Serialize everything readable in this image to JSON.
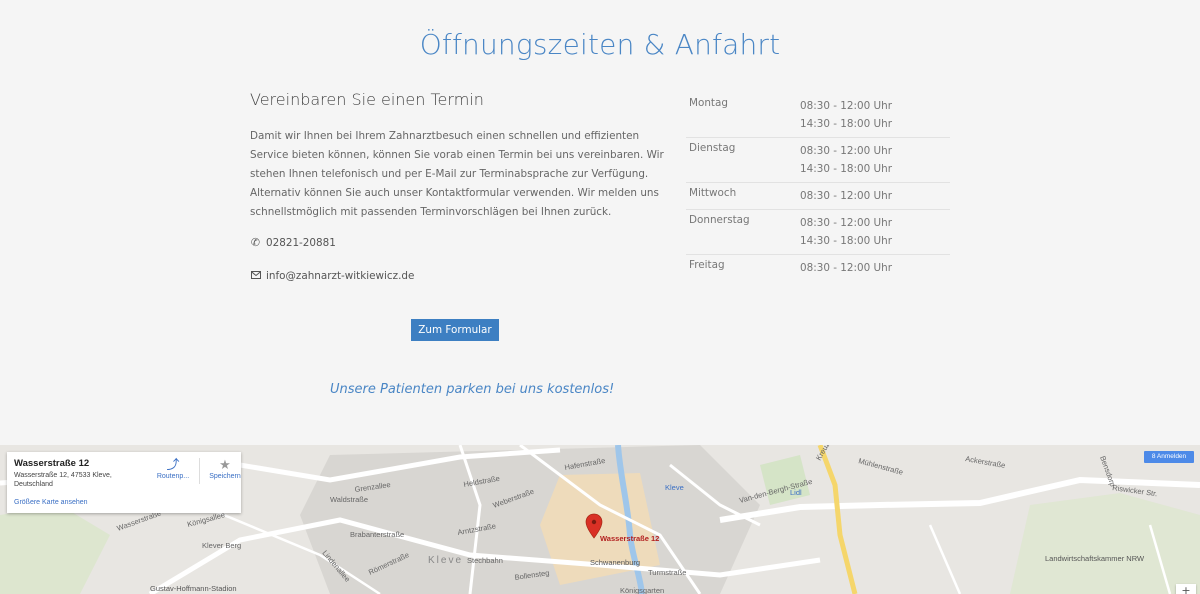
{
  "section": {
    "title": "Öffnungszeiten & Anfahrt",
    "subtitle": "Vereinbaren Sie einen Termin",
    "paragraph": "Damit wir Ihnen bei Ihrem Zahnarztbesuch einen schnellen und effizienten Service bieten können, können Sie vorab einen Termin bei uns vereinbaren. Wir stehen Ihnen telefonisch und per E-Mail zur Terminabsprache zur Verfügung. Alternativ können Sie auch unser Kontaktformular verwenden. Wir melden uns schnellstmöglich mit passenden Terminvorschlägen bei Ihnen zurück.",
    "phone": "02821-20881",
    "email": "info@zahnarzt-witkiewicz.de",
    "form_button": "Zum Formular",
    "parking_note": "Unsere Patienten parken bei uns kostenlos!"
  },
  "hours": [
    {
      "day": "Montag",
      "times": [
        "08:30 - 12:00 Uhr",
        "14:30 - 18:00 Uhr"
      ]
    },
    {
      "day": "Dienstag",
      "times": [
        "08:30 - 12:00 Uhr",
        "14:30 - 18:00 Uhr"
      ]
    },
    {
      "day": "Mittwoch",
      "times": [
        "08:30 - 12:00 Uhr"
      ]
    },
    {
      "day": "Donnerstag",
      "times": [
        "08:30 - 12:00 Uhr",
        "14:30 - 18:00 Uhr"
      ]
    },
    {
      "day": "Freitag",
      "times": [
        "08:30 - 12:00 Uhr"
      ]
    }
  ],
  "map": {
    "card_title": "Wasserstraße 12",
    "card_address": "Wasserstraße 12, 47533 Kleve, Deutschland",
    "card_link": "Größere Karte ansehen",
    "route_label": "Routenp...",
    "save_label": "Speichern",
    "signin_label": "Anmelden",
    "zoom_in": "+",
    "pin_label": "Wasserstraße 12",
    "labels": {
      "l1": "Wasserstraße",
      "l2": "Grenzallee",
      "l3": "Waldstraße",
      "l4": "Heldstraße",
      "l5": "Hafenstraße",
      "l6": "Weberstraße",
      "l7": "Arntzstraße",
      "l8": "Stechbahn",
      "l9": "Schwanenburg",
      "l10": "Kleve",
      "l11": "Königsallee",
      "l12": "Klever Berg",
      "l13": "Brabanterstraße",
      "l14": "Gustav-Hoffmann-Stadion",
      "l15": "Lidl",
      "l16": "Van-den-Bergh-Straße",
      "l17": "Riswicker Str.",
      "l18": "Landwirtschaftskammer NRW",
      "l19": "Turmstraße",
      "l20": "Bollensteg",
      "l21": "Mühlenstraße",
      "l22": "Bensdorp",
      "l23": "Kleve",
      "l24": "Ackerstraße",
      "l25": "Königsgarten",
      "l26": "Römerstraße",
      "l27": "Lindenallee",
      "l28": "Kreuzstraße"
    }
  },
  "colors": {
    "accent": "#4a86c5",
    "button": "#3d7fc2",
    "map_bg": "#e8e6e2",
    "pin": "#d93025"
  }
}
